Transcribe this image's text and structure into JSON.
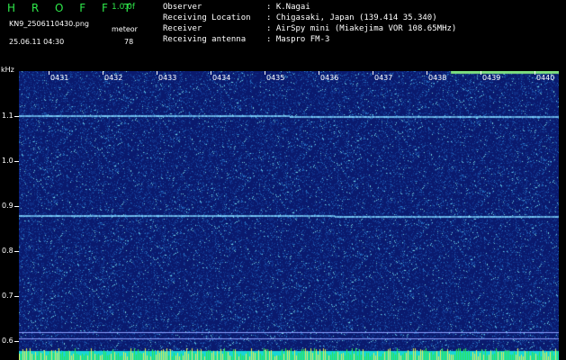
{
  "header": {
    "app_title": "H R O F F T",
    "version": "1.0.0f",
    "filename": "KN9_2506110430.png",
    "timestamp": "25.06.11 04:30",
    "meteor_label": "meteor",
    "meteor_count": "78"
  },
  "info": [
    {
      "label": "Observer",
      "value": ":  K.Nagai"
    },
    {
      "label": "Receiving Location",
      "value": ":  Chigasaki, Japan (139.414 35.340)"
    },
    {
      "label": "Receiver",
      "value": ":  AirSpy mini (Miakejima VOR 108.65MHz)"
    },
    {
      "label": "Receiving antenna",
      "value": ":  Maspro FM-3"
    }
  ],
  "axis": {
    "y_unit": "kHz",
    "y_ticks": [
      "1.1",
      "1.0",
      "0.9",
      "0.8",
      "0.7",
      "0.6"
    ],
    "x_ticks": [
      "0431",
      "0432",
      "0433",
      "0434",
      "0435",
      "0436",
      "0437",
      "0438",
      "0439",
      "0440"
    ]
  },
  "colors": {
    "background": "#0a1a6e",
    "accent_green": "#2ee84a",
    "carrier_line": "#7fd6ff"
  }
}
